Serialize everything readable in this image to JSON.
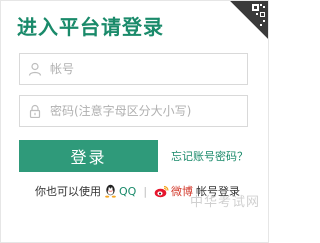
{
  "login": {
    "title": "进入平台请登录",
    "account_placeholder": "帐号",
    "password_placeholder": "密码(注意字母区分大小写)",
    "login_button": "登录",
    "forgot_link": "忘记账号密码？"
  },
  "social": {
    "prefix": "你也可以使用",
    "qq_label": "QQ",
    "separator": "|",
    "weibo_label": "微博",
    "suffix": "帐号登录"
  },
  "watermark": {
    "text": "中华考试网"
  },
  "colors": {
    "title_green": "#1a8a6a",
    "button_green": "#2f9a7a",
    "weibo_red": "#d33a2c"
  },
  "icons": {
    "qr": "qr-code-icon",
    "user": "user-icon",
    "lock": "lock-icon",
    "qq": "qq-penguin-icon",
    "weibo": "weibo-icon"
  }
}
